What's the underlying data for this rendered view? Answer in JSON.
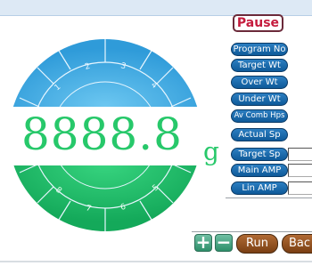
{
  "dial": {
    "upper_segments": [
      "1",
      "2",
      "3",
      "4"
    ],
    "lower_segments": [
      "5",
      "6",
      "7",
      "8"
    ]
  },
  "readout": {
    "value": "8888.8",
    "unit": "g"
  },
  "buttons": {
    "pause": "Pause",
    "program_no": "Program No",
    "target_wt": "Target Wt",
    "over_wt": "Over Wt",
    "under_wt": "Under Wt",
    "av_comb_hps": "Av Comb Hps",
    "actual_sp": "Actual Sp",
    "target_sp": "Target Sp",
    "main_amp": "Main AMP",
    "lin_amp": "Lin AMP",
    "plus": "+",
    "minus": "−",
    "run": "Run",
    "back": "Bac"
  },
  "colors": {
    "upper": "#3fa7e0",
    "lower": "#21c26b",
    "readout": "#27c86a",
    "pill": "#1565a8",
    "run": "#8a4a1c"
  }
}
